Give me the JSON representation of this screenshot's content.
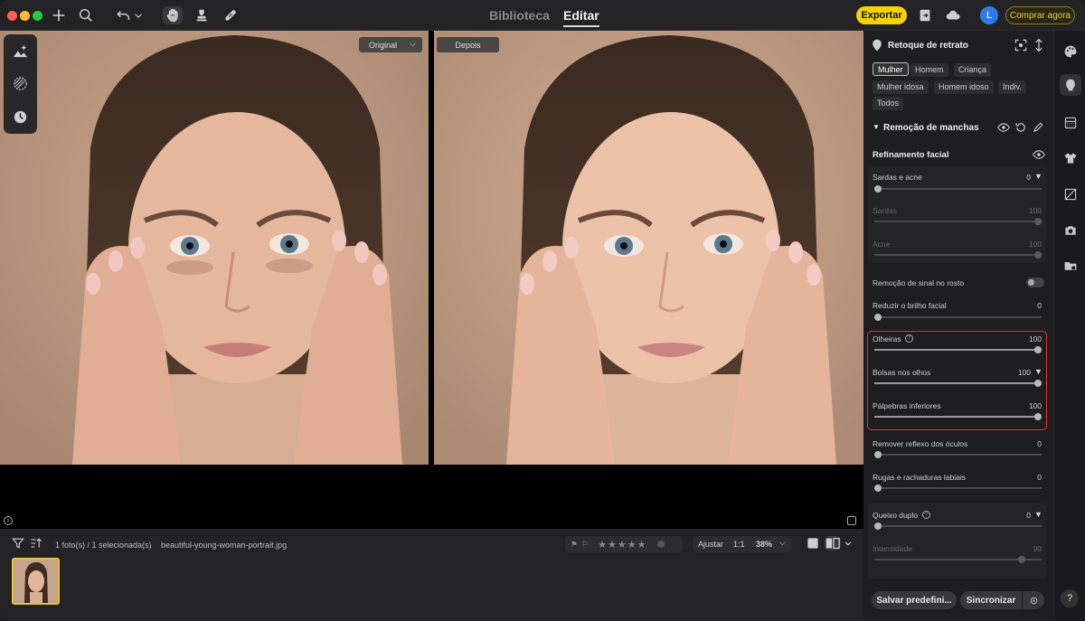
{
  "titlebar": {
    "tabs": [
      {
        "label": "Biblioteca"
      },
      {
        "label": "Editar"
      }
    ],
    "export_label": "Exportar",
    "avatar_initial": "L",
    "buy_label": "Comprar agora",
    "traffic_colors": [
      "#fe5f57",
      "#febc2e",
      "#28c840"
    ]
  },
  "canvas": {
    "view_mode": "Original",
    "after_label": "Depois"
  },
  "filmstrip": {
    "count_text": "1 foto(s) / 1 selecionada(s)",
    "filename": "beautiful-young-woman-portrait.jpg",
    "fit_label": "Ajustar",
    "one_to_one": "1:1",
    "zoom": "38%",
    "stars": "★★★★★"
  },
  "panel": {
    "title": "Retoque de retrato",
    "presets": [
      {
        "label": "Mulher",
        "selected": true
      },
      {
        "label": "Homem"
      },
      {
        "label": "Criança"
      },
      {
        "label": "Mulher idosa"
      },
      {
        "label": "Homem idoso"
      },
      {
        "label": "Indiv."
      },
      {
        "label": "Todos"
      }
    ],
    "section_title": "Remoção de manchas",
    "subsection_title": "Refinamento facial",
    "sliders": [
      {
        "label": "Sardas e acne",
        "value": "0",
        "fraction": 0
      },
      {
        "label": "Sardas",
        "value": "100",
        "fraction": 1
      },
      {
        "label": "Acne",
        "value": "100",
        "fraction": 1
      },
      {
        "label": "Remoção de sinal no rosto"
      },
      {
        "label": "Reduzir o brilho facial",
        "value": "0",
        "fraction": 0
      },
      {
        "label": "Olheiras",
        "value": "100",
        "fraction": 1
      },
      {
        "label": "Bolsas nos olhos",
        "value": "100",
        "fraction": 1
      },
      {
        "label": "Pálpebras inferiores",
        "value": "100",
        "fraction": 1
      },
      {
        "label": "Remover reflexo dos óculos",
        "value": "0",
        "fraction": 0
      },
      {
        "label": "Rugas e rachaduras labiais",
        "value": "0",
        "fraction": 0
      },
      {
        "label": "Queixo duplo",
        "value": "0",
        "fraction": 0
      },
      {
        "label": "Intensidade",
        "value": "90",
        "fraction": 0.9
      }
    ],
    "save_preset_label": "Salvar predefini...",
    "sync_label": "Sincronizar"
  },
  "help_label": "?"
}
